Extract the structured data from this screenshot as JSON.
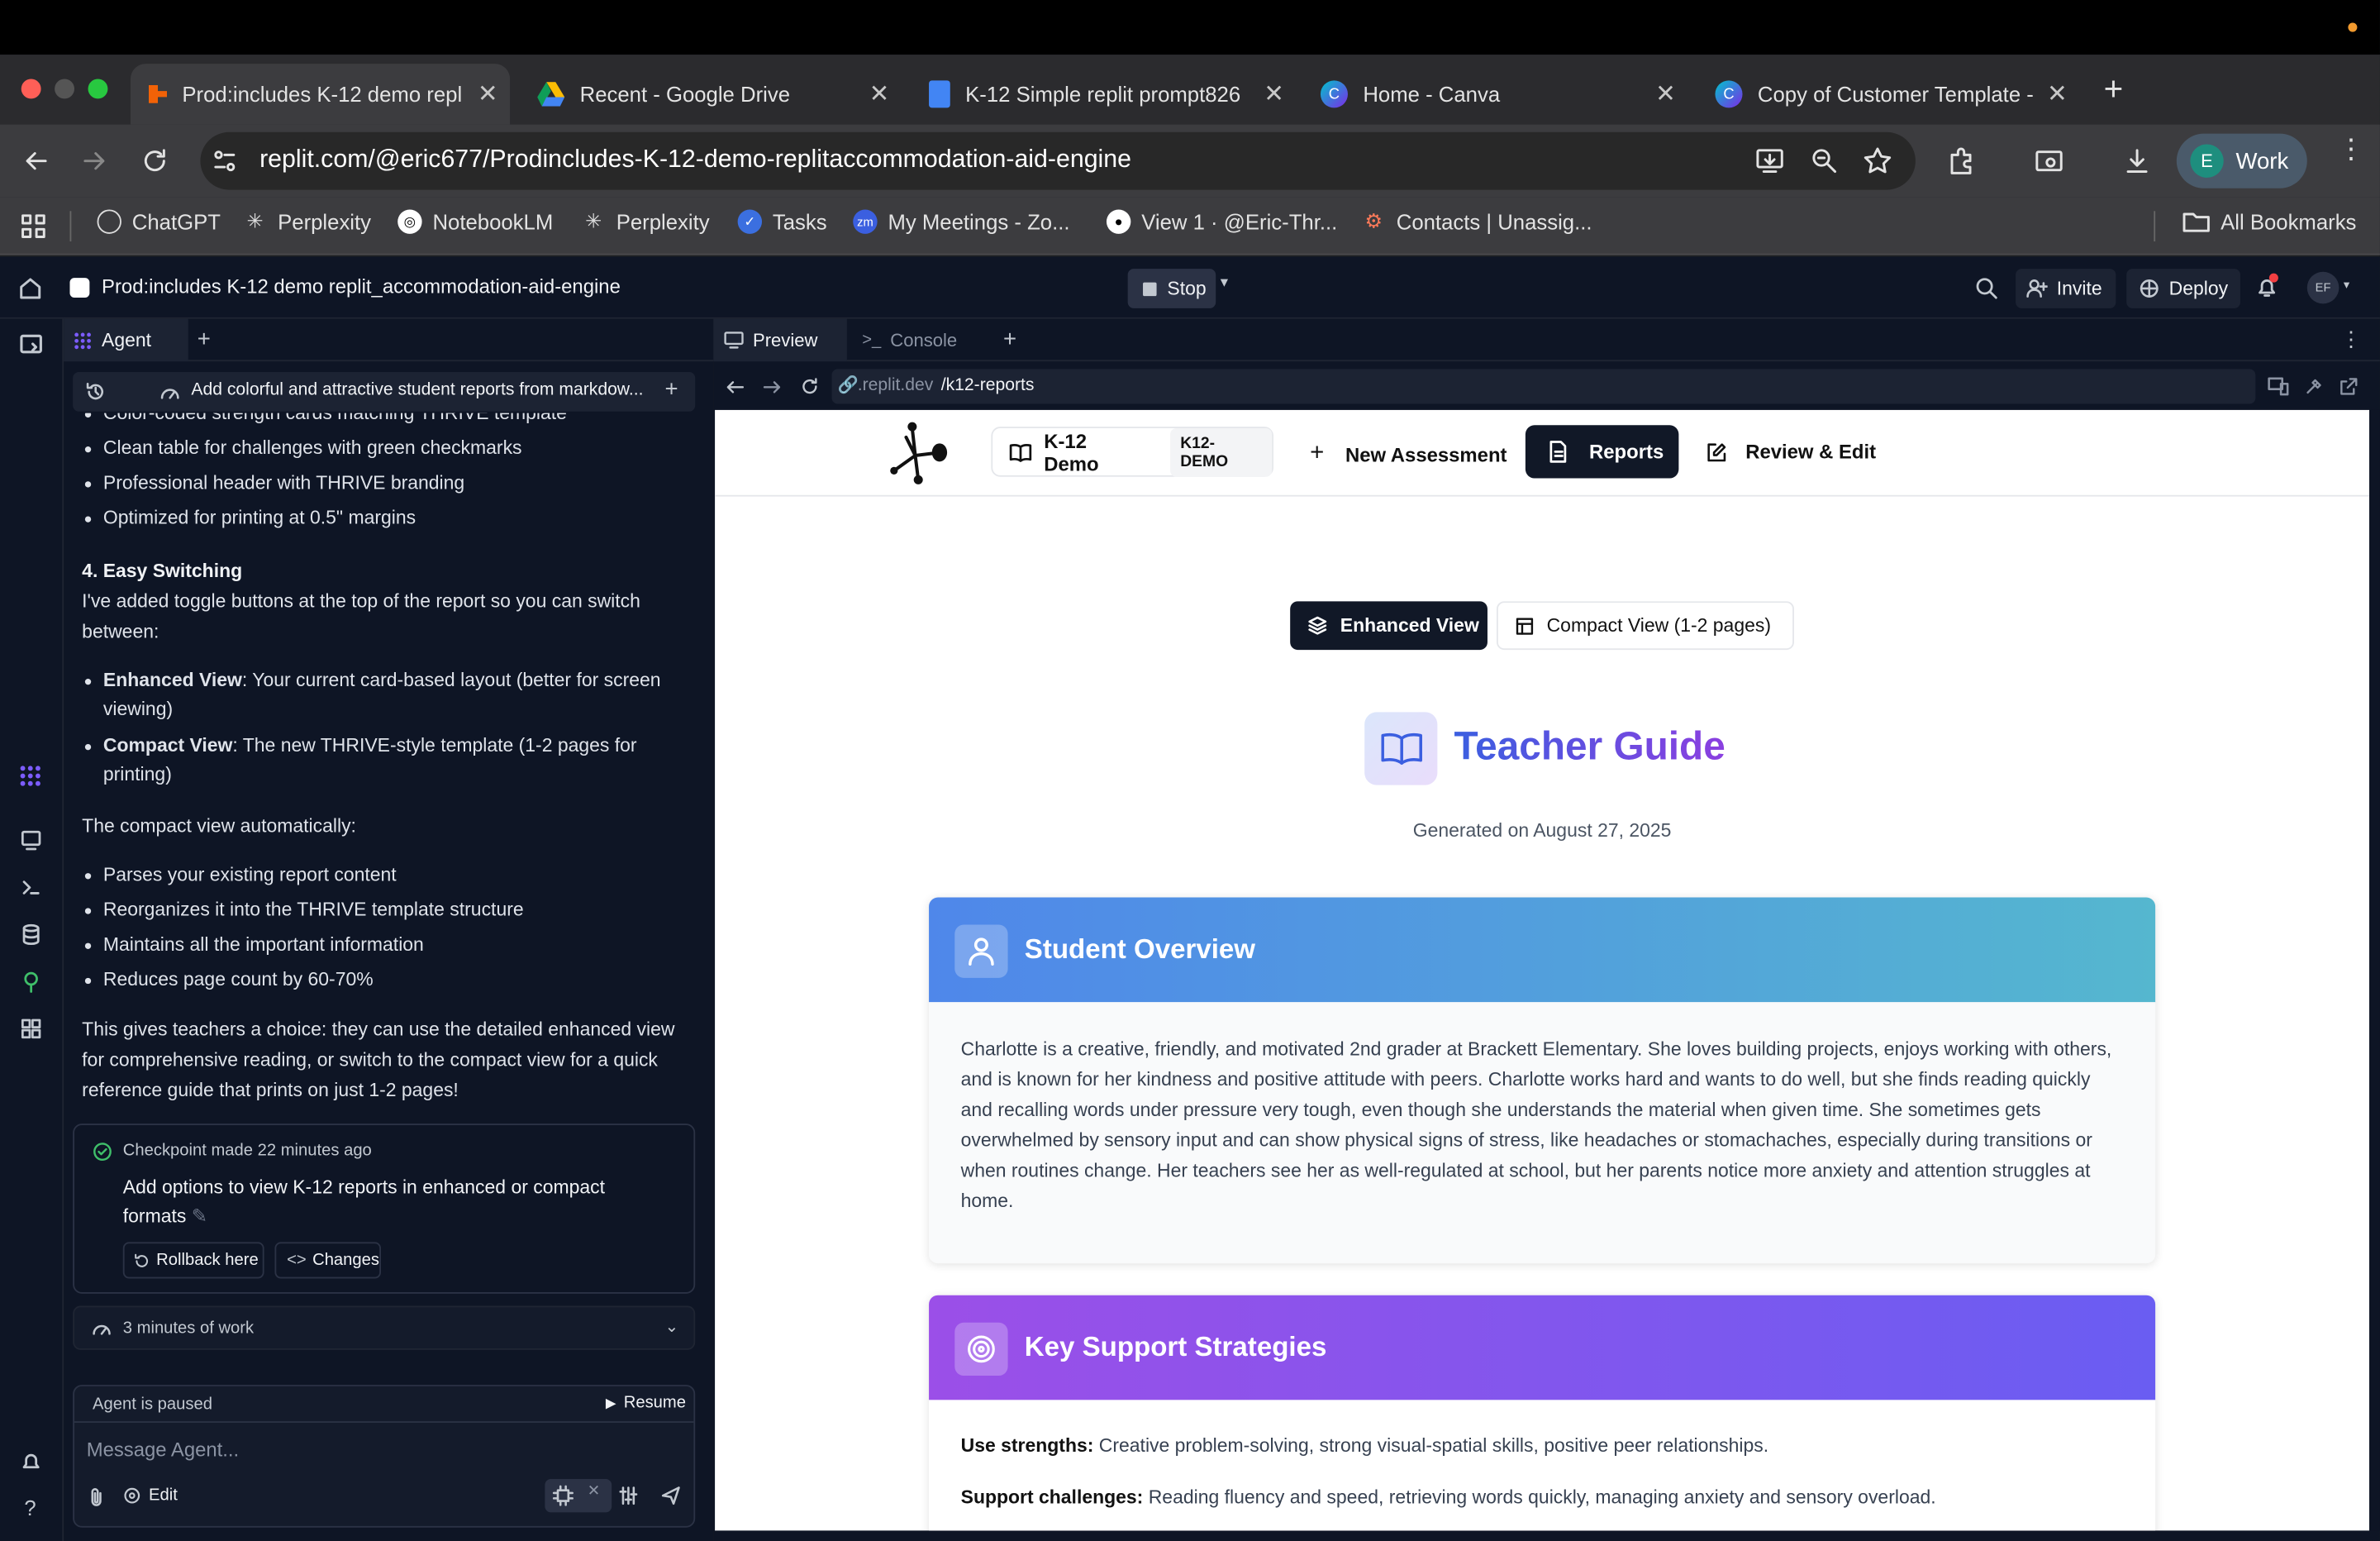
{
  "browser": {
    "tabs": [
      {
        "label": "Prod:includes K-12 demo repl",
        "active": true
      },
      {
        "label": "Recent - Google Drive"
      },
      {
        "label": "K-12 Simple replit prompt826"
      },
      {
        "label": "Home - Canva"
      },
      {
        "label": "Copy of Customer Template -"
      }
    ],
    "url": "replit.com/@eric677/Prodincludes-K-12-demo-replitaccommodation-aid-engine",
    "profile_initial": "E",
    "profile_label": "Work",
    "bookmarks": [
      "ChatGPT",
      "Perplexity",
      "NotebookLM",
      "Perplexity",
      "Tasks",
      "My Meetings - Zo...",
      "View 1 · @Eric-Thr...",
      "Contacts | Unassig..."
    ],
    "all_bookmarks": "All Bookmarks"
  },
  "replit": {
    "project_title": "Prod:includes K-12 demo replit_accommodation-aid-engine",
    "stop_label": "Stop",
    "invite_label": "Invite",
    "deploy_label": "Deploy",
    "avatar_initials": "EF",
    "agent_tab": "Agent",
    "preview_tab": "Preview",
    "console_tab": "Console",
    "preview_url_prefix": ".replit.dev",
    "preview_url_path": "/k12-reports"
  },
  "agent": {
    "thread_title": "Add colorful and attractive student reports from markdow...",
    "partial_line": "Color-coded strength cards matching THRIVE template",
    "list1": [
      "Clean table for challenges with green checkmarks",
      "Professional header with THRIVE branding",
      "Optimized for printing at 0.5\" margins"
    ],
    "section_heading": "4. Easy Switching",
    "section_intro": "I've added toggle buttons at the top of the report so you can switch between:",
    "list2": [
      {
        "term": "Enhanced View",
        "text": ": Your current card-based layout (better for screen viewing)"
      },
      {
        "term": "Compact View",
        "text": ": The new THRIVE-style template (1-2 pages for printing)"
      }
    ],
    "compact_intro": "The compact view automatically:",
    "list3": [
      "Parses your existing report content",
      "Reorganizes it into the THRIVE template structure",
      "Maintains all the important information",
      "Reduces page count by 60-70%"
    ],
    "closing": "This gives teachers a choice: they can use the detailed enhanced view for comprehensive reading, or switch to the compact view for a quick reference guide that prints on just 1-2 pages!",
    "checkpoint_label": "Checkpoint made",
    "checkpoint_time": "22 minutes ago",
    "checkpoint_text": "Add options to view K-12 reports in enhanced or compact formats",
    "rollback_label": "Rollback here",
    "changes_label": "Changes",
    "work_duration": "3 minutes of work",
    "paused_text": "Agent is paused",
    "resume_label": "Resume",
    "message_placeholder": "Message Agent...",
    "edit_label": "Edit"
  },
  "app": {
    "brand": "K-12 Demo",
    "brand_badge": "K12-DEMO",
    "nav_new": "New Assessment",
    "nav_reports": "Reports",
    "nav_review": "Review & Edit",
    "view_enhanced": "Enhanced View",
    "view_compact": "Compact View (1-2 pages)",
    "title": "Teacher Guide",
    "generated": "Generated on August 27, 2025",
    "overview_title": "Student Overview",
    "overview_text": "Charlotte is a creative, friendly, and motivated 2nd grader at Brackett Elementary. She loves building projects, enjoys working with others, and is known for her kindness and positive attitude with peers. Charlotte works hard and wants to do well, but she finds reading quickly and recalling words under pressure very tough, even though she understands the material when given time. She sometimes gets overwhelmed by sensory input and can show physical signs of stress, like headaches or stomachaches, especially during transitions or when routines change. Her teachers see her as well-regulated at school, but her parents notice more anxiety and attention struggles at home.",
    "strategies_title": "Key Support Strategies",
    "strengths_label": "Use strengths:",
    "strengths_text": "Creative problem-solving, strong visual-spatial skills, positive peer relationships.",
    "challenges_label": "Support challenges:",
    "challenges_text": "Reading fluency and speed, retrieving words quickly, managing anxiety and sensory overload."
  },
  "colors": {
    "overview_gradient": [
      "#4f87ea",
      "#55b7cf"
    ],
    "strategies_gradient": [
      "#9b4fe8",
      "#6a5df2"
    ],
    "title_gradient": [
      "#3b5fe0",
      "#8b3fe0"
    ],
    "nav_dark": "#111827"
  }
}
